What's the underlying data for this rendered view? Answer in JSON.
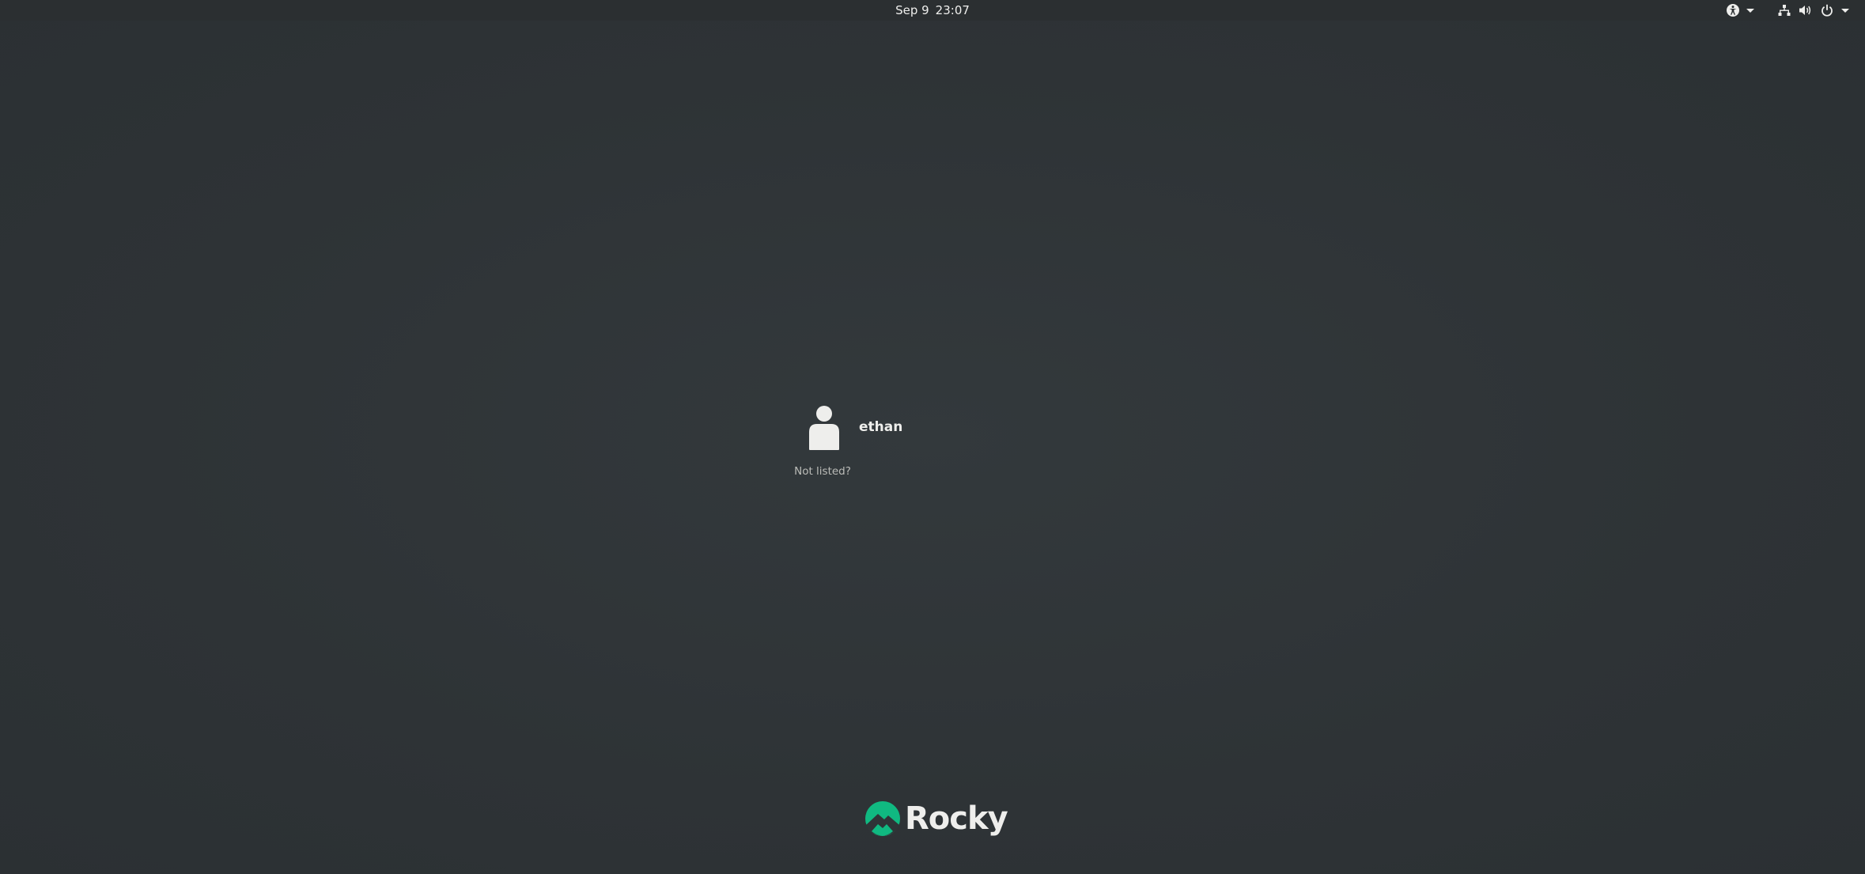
{
  "topbar": {
    "date": "Sep 9",
    "time": "23:07",
    "icons": [
      "accessibility-icon",
      "network-icon",
      "volume-icon",
      "power-icon"
    ]
  },
  "users": [
    {
      "name": "ethan",
      "icon": "user-avatar-icon"
    }
  ],
  "not_listed_label": "Not listed?",
  "branding": {
    "name": "Rocky",
    "accent": "#10b981",
    "icon": "rocky-logo-icon"
  }
}
